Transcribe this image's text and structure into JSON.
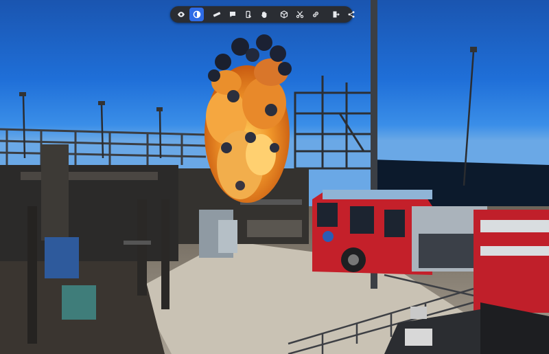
{
  "app": {
    "type": "3d-point-cloud-viewer"
  },
  "toolbar": {
    "active": "contrast",
    "accent_color": "#2e6be6",
    "background_color": "#2a2d33",
    "buttons": [
      {
        "id": "visibility",
        "icon": "eye-icon"
      },
      {
        "id": "contrast",
        "icon": "contrast-icon"
      },
      {
        "id": "measure",
        "icon": "ruler-icon"
      },
      {
        "id": "comment",
        "icon": "comment-icon"
      },
      {
        "id": "annotate",
        "icon": "touch-icon"
      },
      {
        "id": "hand",
        "icon": "hand-icon"
      },
      {
        "id": "box",
        "icon": "box-icon"
      },
      {
        "id": "clip",
        "icon": "scissors-icon"
      },
      {
        "id": "link",
        "icon": "link-icon"
      },
      {
        "id": "export",
        "icon": "export-icon"
      },
      {
        "id": "share",
        "icon": "share-icon"
      }
    ]
  },
  "scene": {
    "description_icons": [
      "explosion-cloud",
      "fire-truck",
      "pipe-rack",
      "light-pole"
    ]
  }
}
